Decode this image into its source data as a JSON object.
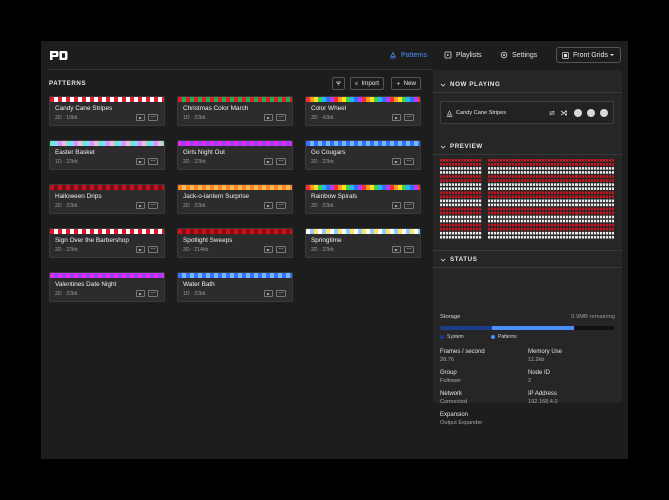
{
  "header": {
    "logo": "PB",
    "nav": [
      {
        "label": "Patterns",
        "icon": "patterns-icon",
        "active": true
      },
      {
        "label": "Playlists",
        "icon": "playlist-icon",
        "active": false
      },
      {
        "label": "Settings",
        "icon": "gear-icon",
        "active": false
      }
    ],
    "grid_select": {
      "icon": "grid-icon",
      "value": "Front Grids"
    }
  },
  "patterns": {
    "title": "PATTERNS",
    "import_label": "Import",
    "new_label": "New",
    "items": [
      {
        "name": "Candy Cane Stripes",
        "meta": "2D · 10kb",
        "strip": "candy"
      },
      {
        "name": "Christmas Color March",
        "meta": "1D · 22kb",
        "strip": "xmas"
      },
      {
        "name": "Color Wheel",
        "meta": "3D · 42kb",
        "strip": "rainbow"
      },
      {
        "name": "Easter Basket",
        "meta": "1D · 22kb",
        "strip": "easter"
      },
      {
        "name": "Girls Night Out",
        "meta": "2D · 22kb",
        "strip": "purple"
      },
      {
        "name": "Go Cougars",
        "meta": "2D · 22kb",
        "strip": "blue"
      },
      {
        "name": "Halloween Drips",
        "meta": "2D · 22kb",
        "strip": "halloween"
      },
      {
        "name": "Jack-o-lantern Surprise",
        "meta": "2D · 22kb",
        "strip": "orange"
      },
      {
        "name": "Rainbow Spirals",
        "meta": "3D · 22kb",
        "strip": "rainbow"
      },
      {
        "name": "Sign Over the Barbershop",
        "meta": "2D · 22kb",
        "strip": "candy"
      },
      {
        "name": "Spotlight Sweeps",
        "meta": "3D · 214kb",
        "strip": "spotlight"
      },
      {
        "name": "Springtime",
        "meta": "2D · 22kb",
        "strip": "spring"
      },
      {
        "name": "Valentines Date Night",
        "meta": "2D · 22kb",
        "strip": "purple"
      },
      {
        "name": "Water Bath",
        "meta": "1D · 22kb",
        "strip": "blue"
      }
    ]
  },
  "now_playing": {
    "title": "NOW PLAYING",
    "pattern": "Candy Cane Stripes"
  },
  "preview": {
    "title": "PREVIEW"
  },
  "status": {
    "title": "STATUS",
    "storage_label": "Storage",
    "storage_remaining": "0.9MB remaining",
    "system_fraction": 0.3,
    "patterns_fraction": 0.47,
    "legend_system": "System",
    "legend_patterns": "Patterns",
    "colors": {
      "system": "#1b3d8a",
      "patterns": "#4c8dff",
      "accent": "#4c8dff"
    },
    "fields": [
      {
        "label": "Frames / second",
        "value": "28.76"
      },
      {
        "label": "Memory Use",
        "value": "11.2kb"
      },
      {
        "label": "Group",
        "value": "Follower"
      },
      {
        "label": "Node ID",
        "value": "2"
      },
      {
        "label": "Network",
        "value": "Connected"
      },
      {
        "label": "IP Address",
        "value": "192.168.4.0"
      },
      {
        "label": "Expansion",
        "value": "Output Expander"
      }
    ]
  }
}
